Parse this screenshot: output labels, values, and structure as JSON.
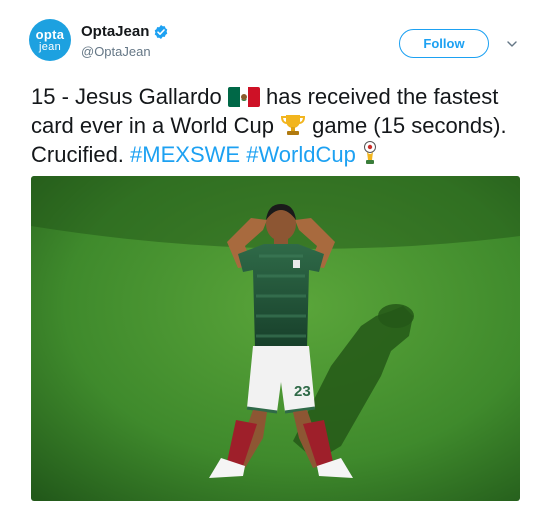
{
  "author": {
    "avatar_text_top": "opta",
    "avatar_text_bottom": "jean",
    "display_name": "OptaJean",
    "handle": "@OptaJean",
    "verified_icon": "verified-badge-icon"
  },
  "actions": {
    "follow_label": "Follow",
    "more_icon": "chevron-down-icon"
  },
  "tweet": {
    "text_1": "15 - Jesus Gallardo ",
    "emoji_flag": "flag-mexico-icon",
    "text_2": " has received the fastest card ever in a World Cup ",
    "emoji_trophy": "trophy-icon",
    "text_3": " game (15 seconds). Crucified. ",
    "hashtag_1": "#MEXSWE",
    "hashtag_2": "#WorldCup",
    "emoji_worldcup": "world-cup-emoji-icon"
  },
  "photo": {
    "subject": "football-player-photo",
    "shirt_number": "23"
  },
  "colors": {
    "brand_blue": "#1da1f2",
    "avatar_blue": "#1da1e0",
    "pitch_green": "#3f8a2c",
    "text": "#14171a",
    "secondary_text": "#657786"
  }
}
